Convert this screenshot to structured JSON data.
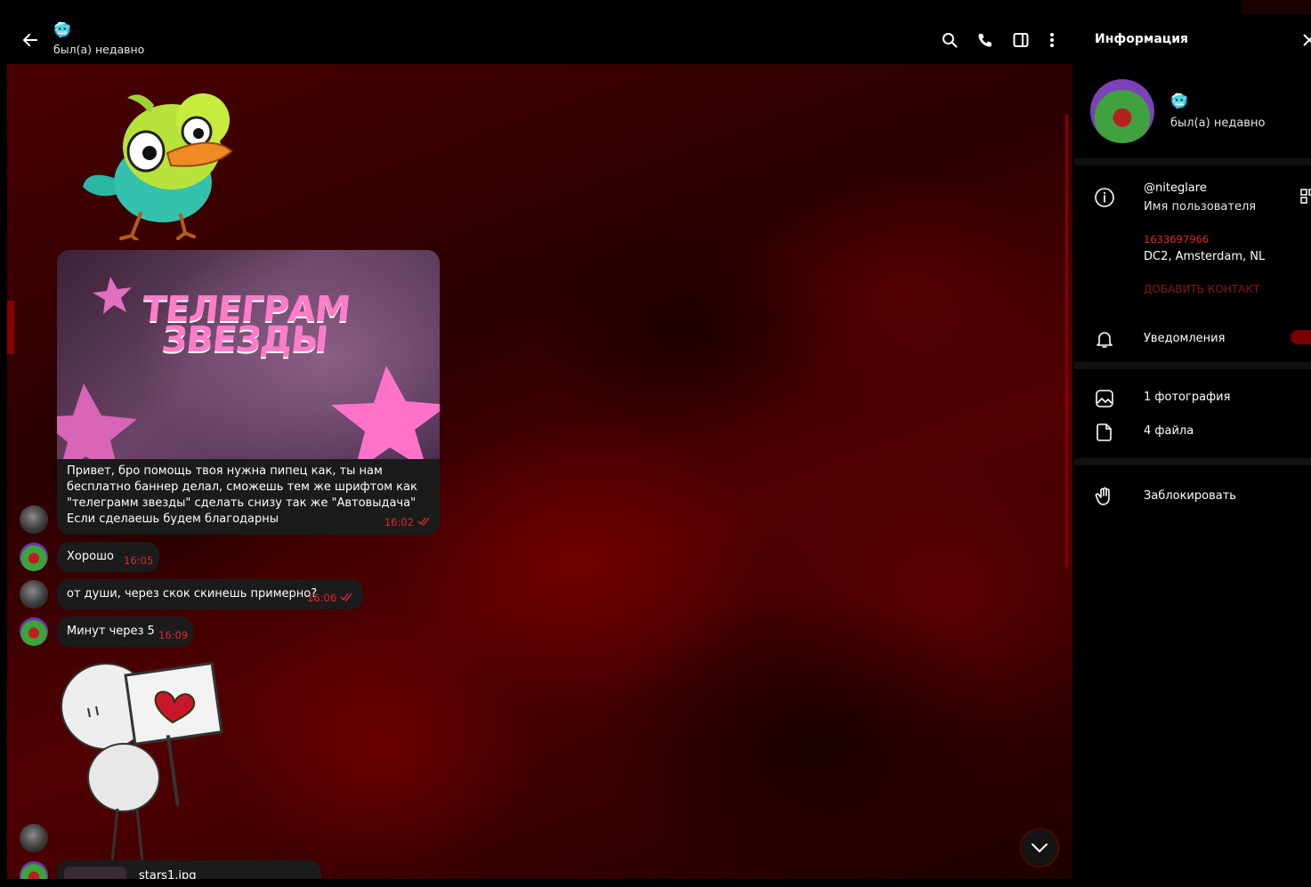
{
  "chat": {
    "peer_emoji": "🥶",
    "peer_status": "был(а) недавно",
    "messages": {
      "banner": {
        "image_title_line1": "ТЕЛЕГРАМ",
        "image_title_line2": "ЗВЕЗДЫ",
        "text": "Привет, бро помощь твоя нужна пипец как, ты нам бесплатно баннер делал, сможешь тем же шрифтом как \"телеграмм звезды\" сделать снизу так же \"Автовыдача\" Если сделаешь будем благодарны",
        "time": "16:02"
      },
      "ok": {
        "text": "Хорошо",
        "time": "16:05"
      },
      "question": {
        "text": "от души, через скок скинешь примерно?",
        "time": "16:06"
      },
      "five": {
        "text": "Минут через 5",
        "time": "16:09"
      },
      "file": {
        "name": "stars1.jpg"
      }
    }
  },
  "info": {
    "title": "Информация",
    "emoji": "🥶",
    "status": "был(а) недавно",
    "username": "@niteglare",
    "username_label": "Имя пользователя",
    "user_id": "1633697966",
    "dc": "DC2, Amsterdam, NL",
    "add_contact": "ДОБАВИТЬ КОНТАКТ",
    "notifications": "Уведомления",
    "photos": "1 фотография",
    "files": "4 файла",
    "block": "Заблокировать"
  },
  "colors": {
    "accent": "#e0262b",
    "bubble": "#1b1b1b",
    "background": "#000000"
  },
  "icons": [
    "back-arrow-icon",
    "search-icon",
    "phone-icon",
    "sidebar-panel-icon",
    "more-vertical-icon",
    "double-check-icon",
    "chevron-down-icon",
    "close-icon",
    "info-icon",
    "qr-code-icon",
    "bell-icon",
    "image-icon",
    "file-icon",
    "hand-icon"
  ]
}
